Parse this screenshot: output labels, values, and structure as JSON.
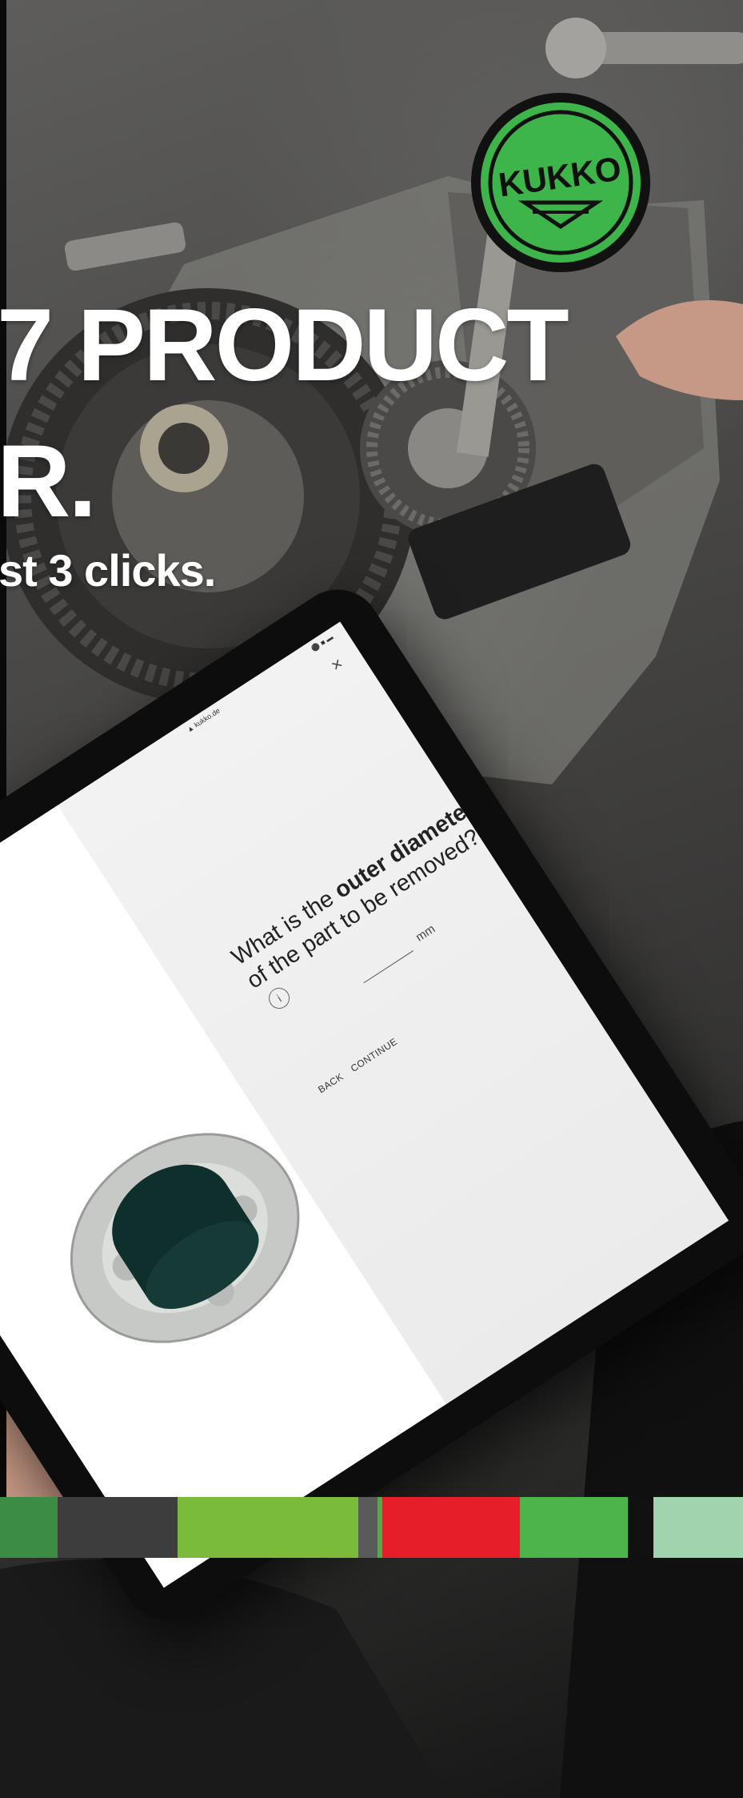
{
  "headline": {
    "line1": "7 PRODUCT",
    "line2": "R.",
    "subline": "st 3 clicks."
  },
  "logo": {
    "text": "KUKKO",
    "color": "#3db54a"
  },
  "tablet": {
    "status_url": "▲ kukko.de",
    "status_right": "⚫ ■ ▬",
    "close_label": "×",
    "question_prefix": "What is the ",
    "question_bold": "outer diameter",
    "question_suffix": " of the part to be removed?",
    "info_label": "i",
    "unit": "mm",
    "back_label": "BACK",
    "continue_label": "CONTINUE"
  },
  "colorbar": [
    "#3c8c44",
    "#3d3d3d",
    "#7bbb3c",
    "#5a5a5a",
    "#5aa84d",
    "#e61e2a",
    "#4cb44b",
    "#111111",
    "#9fd4ae"
  ]
}
